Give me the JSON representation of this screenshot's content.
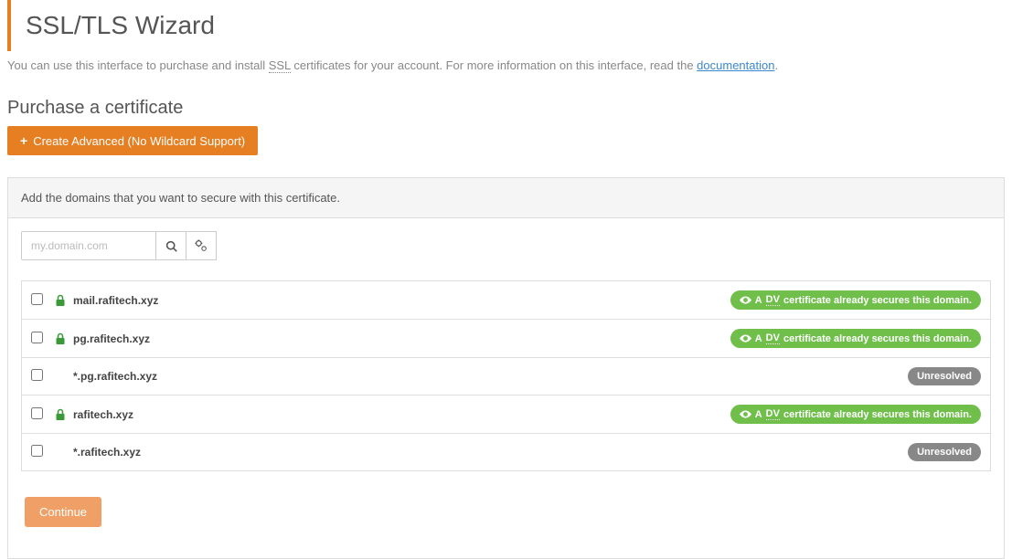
{
  "header": {
    "title": "SSL/TLS Wizard",
    "intro_pre": "You can use this interface to purchase and install ",
    "intro_abbr": "SSL",
    "intro_mid": " certificates for your account. For more information on this interface, read the ",
    "intro_link": "documentation",
    "intro_post": "."
  },
  "purchase": {
    "title": "Purchase a certificate",
    "create_btn": "Create Advanced (No Wildcard Support)"
  },
  "panel": {
    "instruction": "Add the domains that you want to secure with this certificate.",
    "search_placeholder": "my.domain.com"
  },
  "badges": {
    "dv_pre": "A ",
    "dv_abbr": "DV",
    "dv_post": " certificate already secures this domain.",
    "unresolved": "Unresolved"
  },
  "domains": [
    {
      "name": "mail.rafitech.xyz",
      "locked": true,
      "status": "dv"
    },
    {
      "name": "pg.rafitech.xyz",
      "locked": true,
      "status": "dv"
    },
    {
      "name": "*.pg.rafitech.xyz",
      "locked": false,
      "status": "unresolved"
    },
    {
      "name": "rafitech.xyz",
      "locked": true,
      "status": "dv"
    },
    {
      "name": "*.rafitech.xyz",
      "locked": false,
      "status": "unresolved"
    }
  ],
  "actions": {
    "continue": "Continue"
  }
}
